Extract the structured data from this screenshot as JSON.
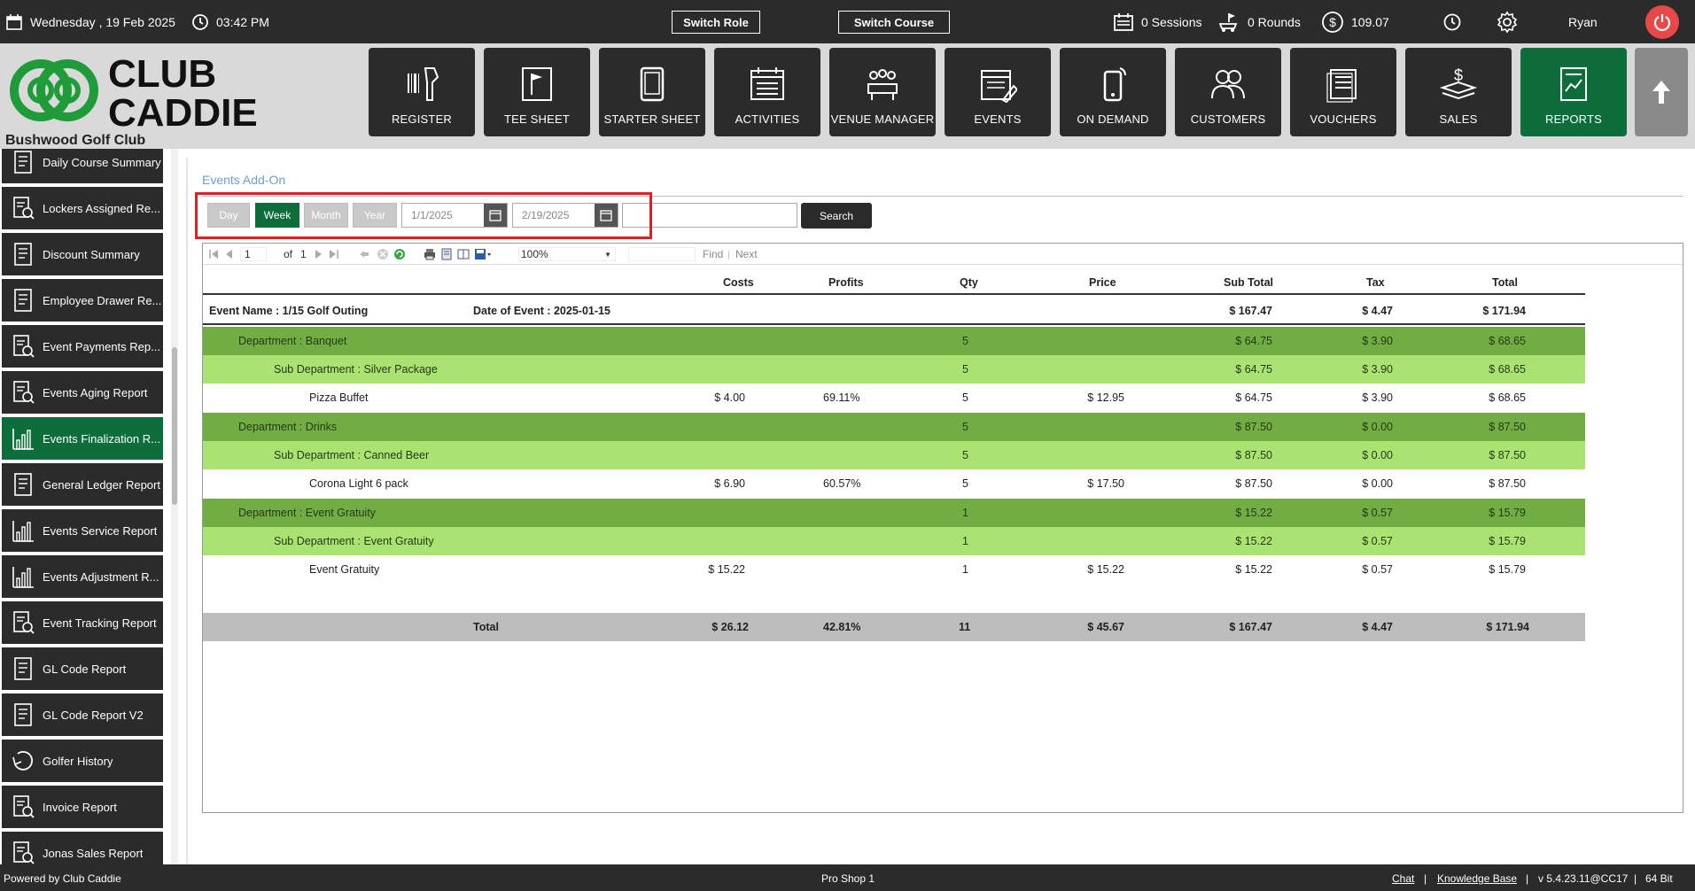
{
  "topbar": {
    "date": "Wednesday , 19 Feb 2025",
    "time": "03:42 PM",
    "switch_role": "Switch Role",
    "switch_course": "Switch Course",
    "sessions": "0 Sessions",
    "rounds": "0 Rounds",
    "balance": "109.07",
    "user": "Ryan"
  },
  "brand": {
    "logo_line1": "CLUB",
    "logo_line2": "CADDIE",
    "club_name": "Bushwood Golf Club"
  },
  "nav": [
    {
      "label": "REGISTER",
      "icon": "barcode-scanner-icon"
    },
    {
      "label": "TEE SHEET",
      "icon": "flag-board-icon"
    },
    {
      "label": "STARTER SHEET",
      "icon": "tablet-icon"
    },
    {
      "label": "ACTIVITIES",
      "icon": "calendar-list-icon"
    },
    {
      "label": "VENUE MANAGER",
      "icon": "meeting-table-icon"
    },
    {
      "label": "EVENTS",
      "icon": "calendar-edit-icon"
    },
    {
      "label": "ON DEMAND",
      "icon": "mobile-phone-icon"
    },
    {
      "label": "CUSTOMERS",
      "icon": "people-icon"
    },
    {
      "label": "VOUCHERS",
      "icon": "voucher-stack-icon"
    },
    {
      "label": "SALES",
      "icon": "dollar-stack-icon"
    },
    {
      "label": "REPORTS",
      "icon": "report-chart-icon"
    }
  ],
  "sidebar": {
    "items": [
      {
        "label": "Daily Course Summary",
        "icon": "report-doc-icon"
      },
      {
        "label": "Lockers Assigned Re...",
        "icon": "report-search-icon"
      },
      {
        "label": "Discount Summary",
        "icon": "report-doc-icon"
      },
      {
        "label": "Employee Drawer Re...",
        "icon": "report-doc-icon"
      },
      {
        "label": "Event Payments Rep...",
        "icon": "report-search-icon"
      },
      {
        "label": "Events Aging Report",
        "icon": "report-search-icon"
      },
      {
        "label": "Events Finalization R...",
        "icon": "bar-chart-icon"
      },
      {
        "label": "General Ledger Report",
        "icon": "report-doc-icon"
      },
      {
        "label": "Events Service Report",
        "icon": "bar-chart-icon"
      },
      {
        "label": "Events Adjustment R...",
        "icon": "bar-chart-icon"
      },
      {
        "label": "Event Tracking Report",
        "icon": "report-search-icon"
      },
      {
        "label": "GL Code Report",
        "icon": "report-doc-icon"
      },
      {
        "label": "GL Code Report V2",
        "icon": "report-doc-icon"
      },
      {
        "label": "Golfer History",
        "icon": "history-icon"
      },
      {
        "label": "Invoice Report",
        "icon": "report-search-icon"
      },
      {
        "label": "Jonas Sales Report",
        "icon": "report-search-icon"
      }
    ]
  },
  "content": {
    "breadcrumb": "Events Add-On",
    "periods": [
      "Day",
      "Week",
      "Month",
      "Year"
    ],
    "start_date": "1/1/2025",
    "end_date": "2/19/2025",
    "search_label": "Search"
  },
  "viewer": {
    "page": "1",
    "of_label": "of",
    "total_pages": "1",
    "zoom": "100%",
    "find": "Find",
    "next": "Next"
  },
  "report": {
    "headers": {
      "costs": "Costs",
      "profits": "Profits",
      "qty": "Qty",
      "price": "Price",
      "subtotal": "Sub Total",
      "tax": "Tax",
      "total": "Total"
    },
    "event": {
      "name": "Event Name : 1/15 Golf Outing",
      "date": "Date of Event : 2025-01-15",
      "subtotal": "$ 167.47",
      "tax": "$ 4.47",
      "total": "$ 171.94"
    },
    "rows": [
      {
        "kind": "dept",
        "label": "Department : Banquet",
        "costs": "",
        "profits": "",
        "qty": "5",
        "price": "",
        "subtotal": "$ 64.75",
        "tax": "$ 3.90",
        "total": "$ 68.65"
      },
      {
        "kind": "sub",
        "label": "Sub Department : Silver Package",
        "costs": "",
        "profits": "",
        "qty": "5",
        "price": "",
        "subtotal": "$ 64.75",
        "tax": "$ 3.90",
        "total": "$ 68.65"
      },
      {
        "kind": "item",
        "label": "Pizza Buffet",
        "costs": "$ 4.00",
        "profits": "69.11%",
        "qty": "5",
        "price": "$ 12.95",
        "subtotal": "$ 64.75",
        "tax": "$ 3.90",
        "total": "$ 68.65"
      },
      {
        "kind": "dept",
        "label": "Department : Drinks",
        "costs": "",
        "profits": "",
        "qty": "5",
        "price": "",
        "subtotal": "$ 87.50",
        "tax": "$ 0.00",
        "total": "$ 87.50"
      },
      {
        "kind": "sub",
        "label": "Sub Department : Canned Beer",
        "costs": "",
        "profits": "",
        "qty": "5",
        "price": "",
        "subtotal": "$ 87.50",
        "tax": "$ 0.00",
        "total": "$ 87.50"
      },
      {
        "kind": "item",
        "label": "Corona Light 6 pack",
        "costs": "$ 6.90",
        "profits": "60.57%",
        "qty": "5",
        "price": "$ 17.50",
        "subtotal": "$ 87.50",
        "tax": "$ 0.00",
        "total": "$ 87.50"
      },
      {
        "kind": "dept",
        "label": "Department : Event Gratuity",
        "costs": "",
        "profits": "",
        "qty": "1",
        "price": "",
        "subtotal": "$ 15.22",
        "tax": "$ 0.57",
        "total": "$ 15.79"
      },
      {
        "kind": "sub",
        "label": "Sub Department : Event Gratuity",
        "costs": "",
        "profits": "",
        "qty": "1",
        "price": "",
        "subtotal": "$ 15.22",
        "tax": "$ 0.57",
        "total": "$ 15.79"
      },
      {
        "kind": "item",
        "label": "Event Gratuity",
        "costs": "$ 15.22",
        "profits": "",
        "qty": "1",
        "price": "$ 15.22",
        "subtotal": "$ 15.22",
        "tax": "$ 0.57",
        "total": "$ 15.79"
      }
    ],
    "totals": {
      "label": "Total",
      "costs": "$ 26.12",
      "profits": "42.81%",
      "qty": "11",
      "price": "$ 45.67",
      "subtotal": "$ 167.47",
      "tax": "$ 4.47",
      "total": "$ 171.94"
    }
  },
  "footer": {
    "powered": "Powered by Club Caddie",
    "location": "Pro Shop 1",
    "chat": "Chat",
    "kb": "Knowledge Base",
    "version": "v 5.4.23.11@CC17",
    "bits": "64 Bit",
    "sep": "|"
  },
  "colors": {
    "brand_green": "#0d6e3c",
    "dark": "#2b2b2b",
    "dept_row": "#72ad43",
    "sub_row": "#abe373",
    "total_row": "#bdbdbd",
    "highlight": "#e02020"
  }
}
